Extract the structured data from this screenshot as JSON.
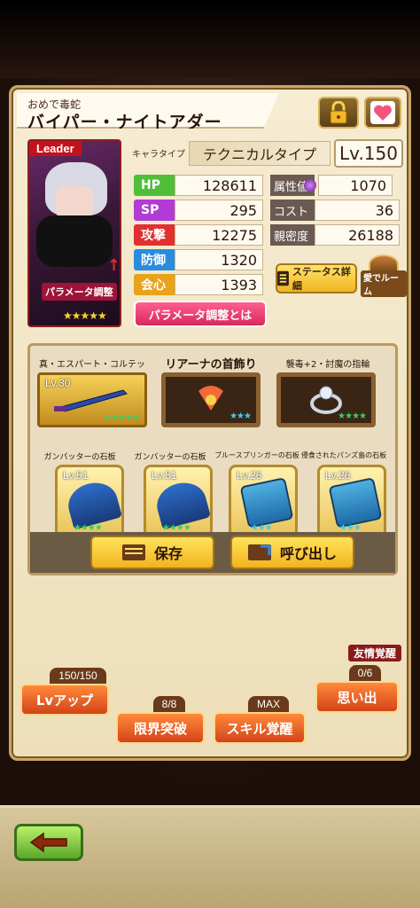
{
  "header": {
    "subtitle": "おめで毒蛇",
    "name": "バイパー・ナイトアダー"
  },
  "portrait": {
    "leader_badge": "Leader",
    "param_badge": "パラメータ調整",
    "stars": "★★★★★"
  },
  "chara": {
    "type_label": "キャラタイプ",
    "type_value": "テクニカルタイプ",
    "level": "Lv.150"
  },
  "stats": {
    "hp_label": "HP",
    "hp": "128611",
    "sp_label": "SP",
    "sp": "295",
    "atk_label": "攻撃",
    "atk": "12275",
    "def_label": "防御",
    "def": "1320",
    "crit_label": "会心",
    "crit": "1393",
    "attr_label": "属性値",
    "attr": "1070",
    "cost_label": "コスト",
    "cost": "36",
    "affection_label": "親密度",
    "affection": "26188"
  },
  "buttons": {
    "status_detail": "ステータス詳細",
    "room": "愛でルーム",
    "param_info": "パラメータ調整とは",
    "save": "保存",
    "load": "呼び出し"
  },
  "equipment": {
    "weapon": {
      "name": "真・エスパート・コルテッロ",
      "level": "Lv.30",
      "stars": "★★★★★"
    },
    "accessory1": {
      "name": "リアーナの首飾り",
      "stars": "★★★"
    },
    "accessory2": {
      "name": "襲毒+2・討魔の指輪",
      "stars": "★★★★"
    }
  },
  "stones": [
    {
      "name": "ガンバッターの石板",
      "level": "Lv.51",
      "stars": "★★★★"
    },
    {
      "name": "ガンバッターの石板",
      "level": "Lv.51",
      "stars": "★★★★"
    },
    {
      "name": "ブルースプリンガーの石板",
      "level": "Lv.26",
      "stars": "★★★"
    },
    {
      "name": "侵食されたパンズ島の石板",
      "level": "Lv.26",
      "stars": "★★★"
    }
  ],
  "bottom": {
    "lvup_count": "150/150",
    "lvup_label": "Lvアップ",
    "limit_count": "8/8",
    "limit_label": "限界突破",
    "skill_count": "MAX",
    "skill_label": "スキル覚醒",
    "memory_badge": "友情覚醒",
    "memory_count": "0/6",
    "memory_label": "思い出"
  },
  "colors": {
    "hp": "#4fbf3a",
    "sp": "#b23bd6",
    "atk": "#e03030",
    "def": "#2a8ce0",
    "crit": "#e8a31a"
  }
}
